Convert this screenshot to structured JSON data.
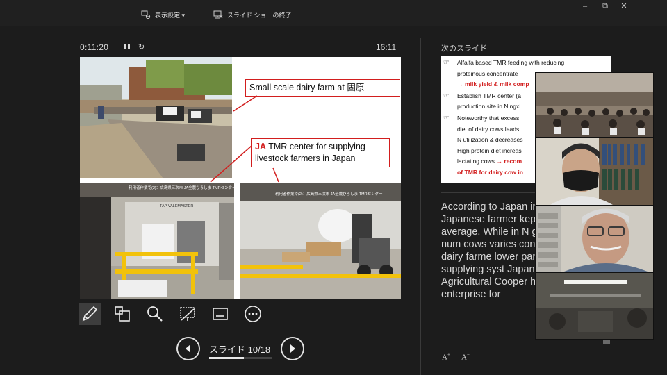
{
  "toolbar": {
    "display_settings_label": "表示設定 ▾",
    "end_show_label": "スライド ショーの終了"
  },
  "window_controls": {
    "minimize": "–",
    "restore": "⧉",
    "close": "✕"
  },
  "presenter": {
    "elapsed_time": "0:11:20",
    "clock": "16:11"
  },
  "slide": {
    "callout_top": "Small scale dairy farm at 固原",
    "callout_ja_prefix": "JA",
    "callout_ja_rest": " TMR center for supplying livestock farmers in Japan",
    "photo_left_caption": "利用者作業で(2)：広島県三次市 JA全農ひろしま TMRセンター",
    "photo_right_caption": "利用者作業で(2)：広島県三次市 JA全農ひろしま TMRセンター",
    "machine_brand": "TAP VALEMASTER"
  },
  "navigation": {
    "slide_indicator": "スライド 10/18",
    "current": 10,
    "total": 18
  },
  "next_slide": {
    "label": "次のスライド",
    "bullets": [
      {
        "lines": [
          {
            "text": "Alfalfa based TMR feeding with reducing"
          },
          {
            "text": "proteinous concentrate",
            "red": ""
          },
          {
            "text": "",
            "red": "→ milk yield & milk comp"
          }
        ]
      },
      {
        "lines": [
          {
            "text": "Establish TMR center (a"
          },
          {
            "text": "production site in Ningxi"
          }
        ]
      },
      {
        "lines": [
          {
            "text": "Noteworthy that excess"
          },
          {
            "text": "diet of dairy cows leads"
          },
          {
            "text": "N utilization & decreases"
          },
          {
            "text": "High protein diet increas"
          },
          {
            "text": "lactating cows ",
            "red": "→ recom"
          },
          {
            "text": "",
            "red": "of TMR for dairy cow in"
          }
        ]
      }
    ]
  },
  "notes": {
    "text": "According to Japan in 2020, Japanese farmer kept 95 hea average. While in N guess that the num cows varies consid across dairy farme lower panels show feed supplying syst Japan. In here JA: Agricultural Cooper huge corporate enterprise for"
  },
  "font_controls": {
    "increase": "A",
    "decrease": "A"
  },
  "colors": {
    "background": "#1c1c1c",
    "accent_red": "#d21e1e",
    "slide_bg": "#ffffff"
  }
}
